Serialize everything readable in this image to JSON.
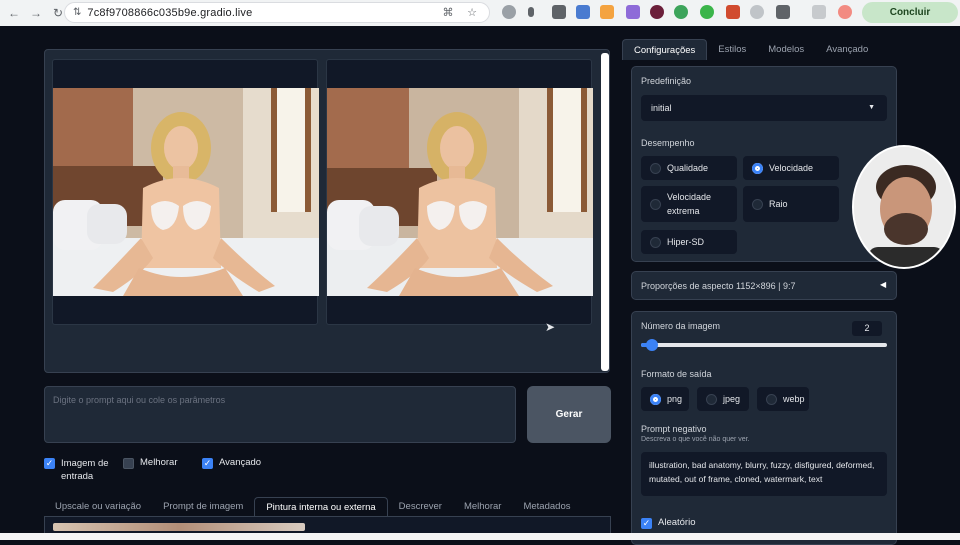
{
  "browser": {
    "url": "7c8f9708866c035b9e.gradio.live",
    "update_label": "Concluir atualização"
  },
  "prompt": {
    "placeholder": "Digite o prompt aqui ou cole os parâmetros",
    "generate_label": "Gerar"
  },
  "options": {
    "input_image": "Imagem de entrada",
    "enhance": "Melhorar",
    "advanced": "Avançado"
  },
  "bottom_tabs": [
    "Upscale ou variação",
    "Prompt de imagem",
    "Pintura interna ou externa",
    "Descrever",
    "Melhorar",
    "Metadados"
  ],
  "right_tabs": [
    "Configurações",
    "Estilos",
    "Modelos",
    "Avançado"
  ],
  "preset": {
    "label": "Predefinição",
    "value": "initial"
  },
  "performance": {
    "label": "Desempenho",
    "options": [
      "Qualidade",
      "Velocidade",
      "Velocidade extrema",
      "Raio",
      "Hiper-SD"
    ]
  },
  "aspect": {
    "label": "Proporções de aspecto 1152×896 | 9:7"
  },
  "image_number": {
    "label": "Número da imagem",
    "value": "2",
    "fraction": 0.03
  },
  "output_format": {
    "label": "Formato de saída",
    "options": [
      "png",
      "jpeg",
      "webp"
    ]
  },
  "negative": {
    "label": "Prompt negativo",
    "hint": "Descreva o que você não quer ver.",
    "value": "illustration, bad anatomy, blurry, fuzzy, disfigured, deformed, mutated, out of frame, cloned, watermark, text"
  },
  "random": {
    "label": "Aleatório"
  },
  "colors": {
    "accent": "#3b82f6",
    "panel": "#1f2937",
    "background": "#0b0f19"
  }
}
